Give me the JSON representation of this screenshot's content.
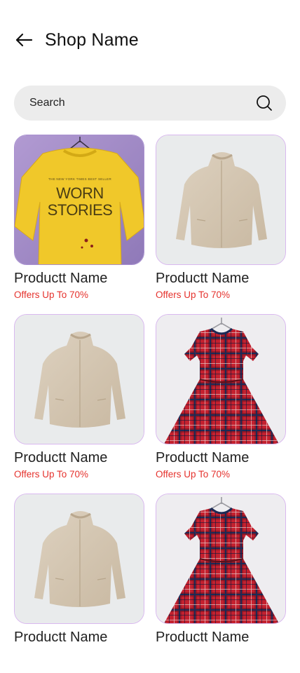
{
  "header": {
    "title": "Shop Name",
    "back_icon": "arrow-left-icon"
  },
  "search": {
    "placeholder": "Search",
    "icon": "search-icon"
  },
  "colors": {
    "offer_text": "#e5322d",
    "card_border": "#d9b8ef",
    "search_bg": "#ececec",
    "thumb_bg": "#e9ebec"
  },
  "products": [
    {
      "name": "Productt Name",
      "offer": "Offers Up To 70%",
      "image": "yellow-sweater-worn-stories",
      "sweater_text_line1": "WORN",
      "sweater_text_line2": "STORIES"
    },
    {
      "name": "Productt Name",
      "offer": "Offers Up To 70%",
      "image": "beige-fleece-jacket"
    },
    {
      "name": "Productt Name",
      "offer": "Offers Up To 70%",
      "image": "beige-fleece-jacket"
    },
    {
      "name": "Productt Name",
      "offer": "Offers Up To 70%",
      "image": "red-plaid-dress"
    },
    {
      "name": "Productt Name",
      "offer": "",
      "image": "beige-fleece-jacket"
    },
    {
      "name": "Productt Name",
      "offer": "",
      "image": "red-plaid-dress"
    }
  ]
}
